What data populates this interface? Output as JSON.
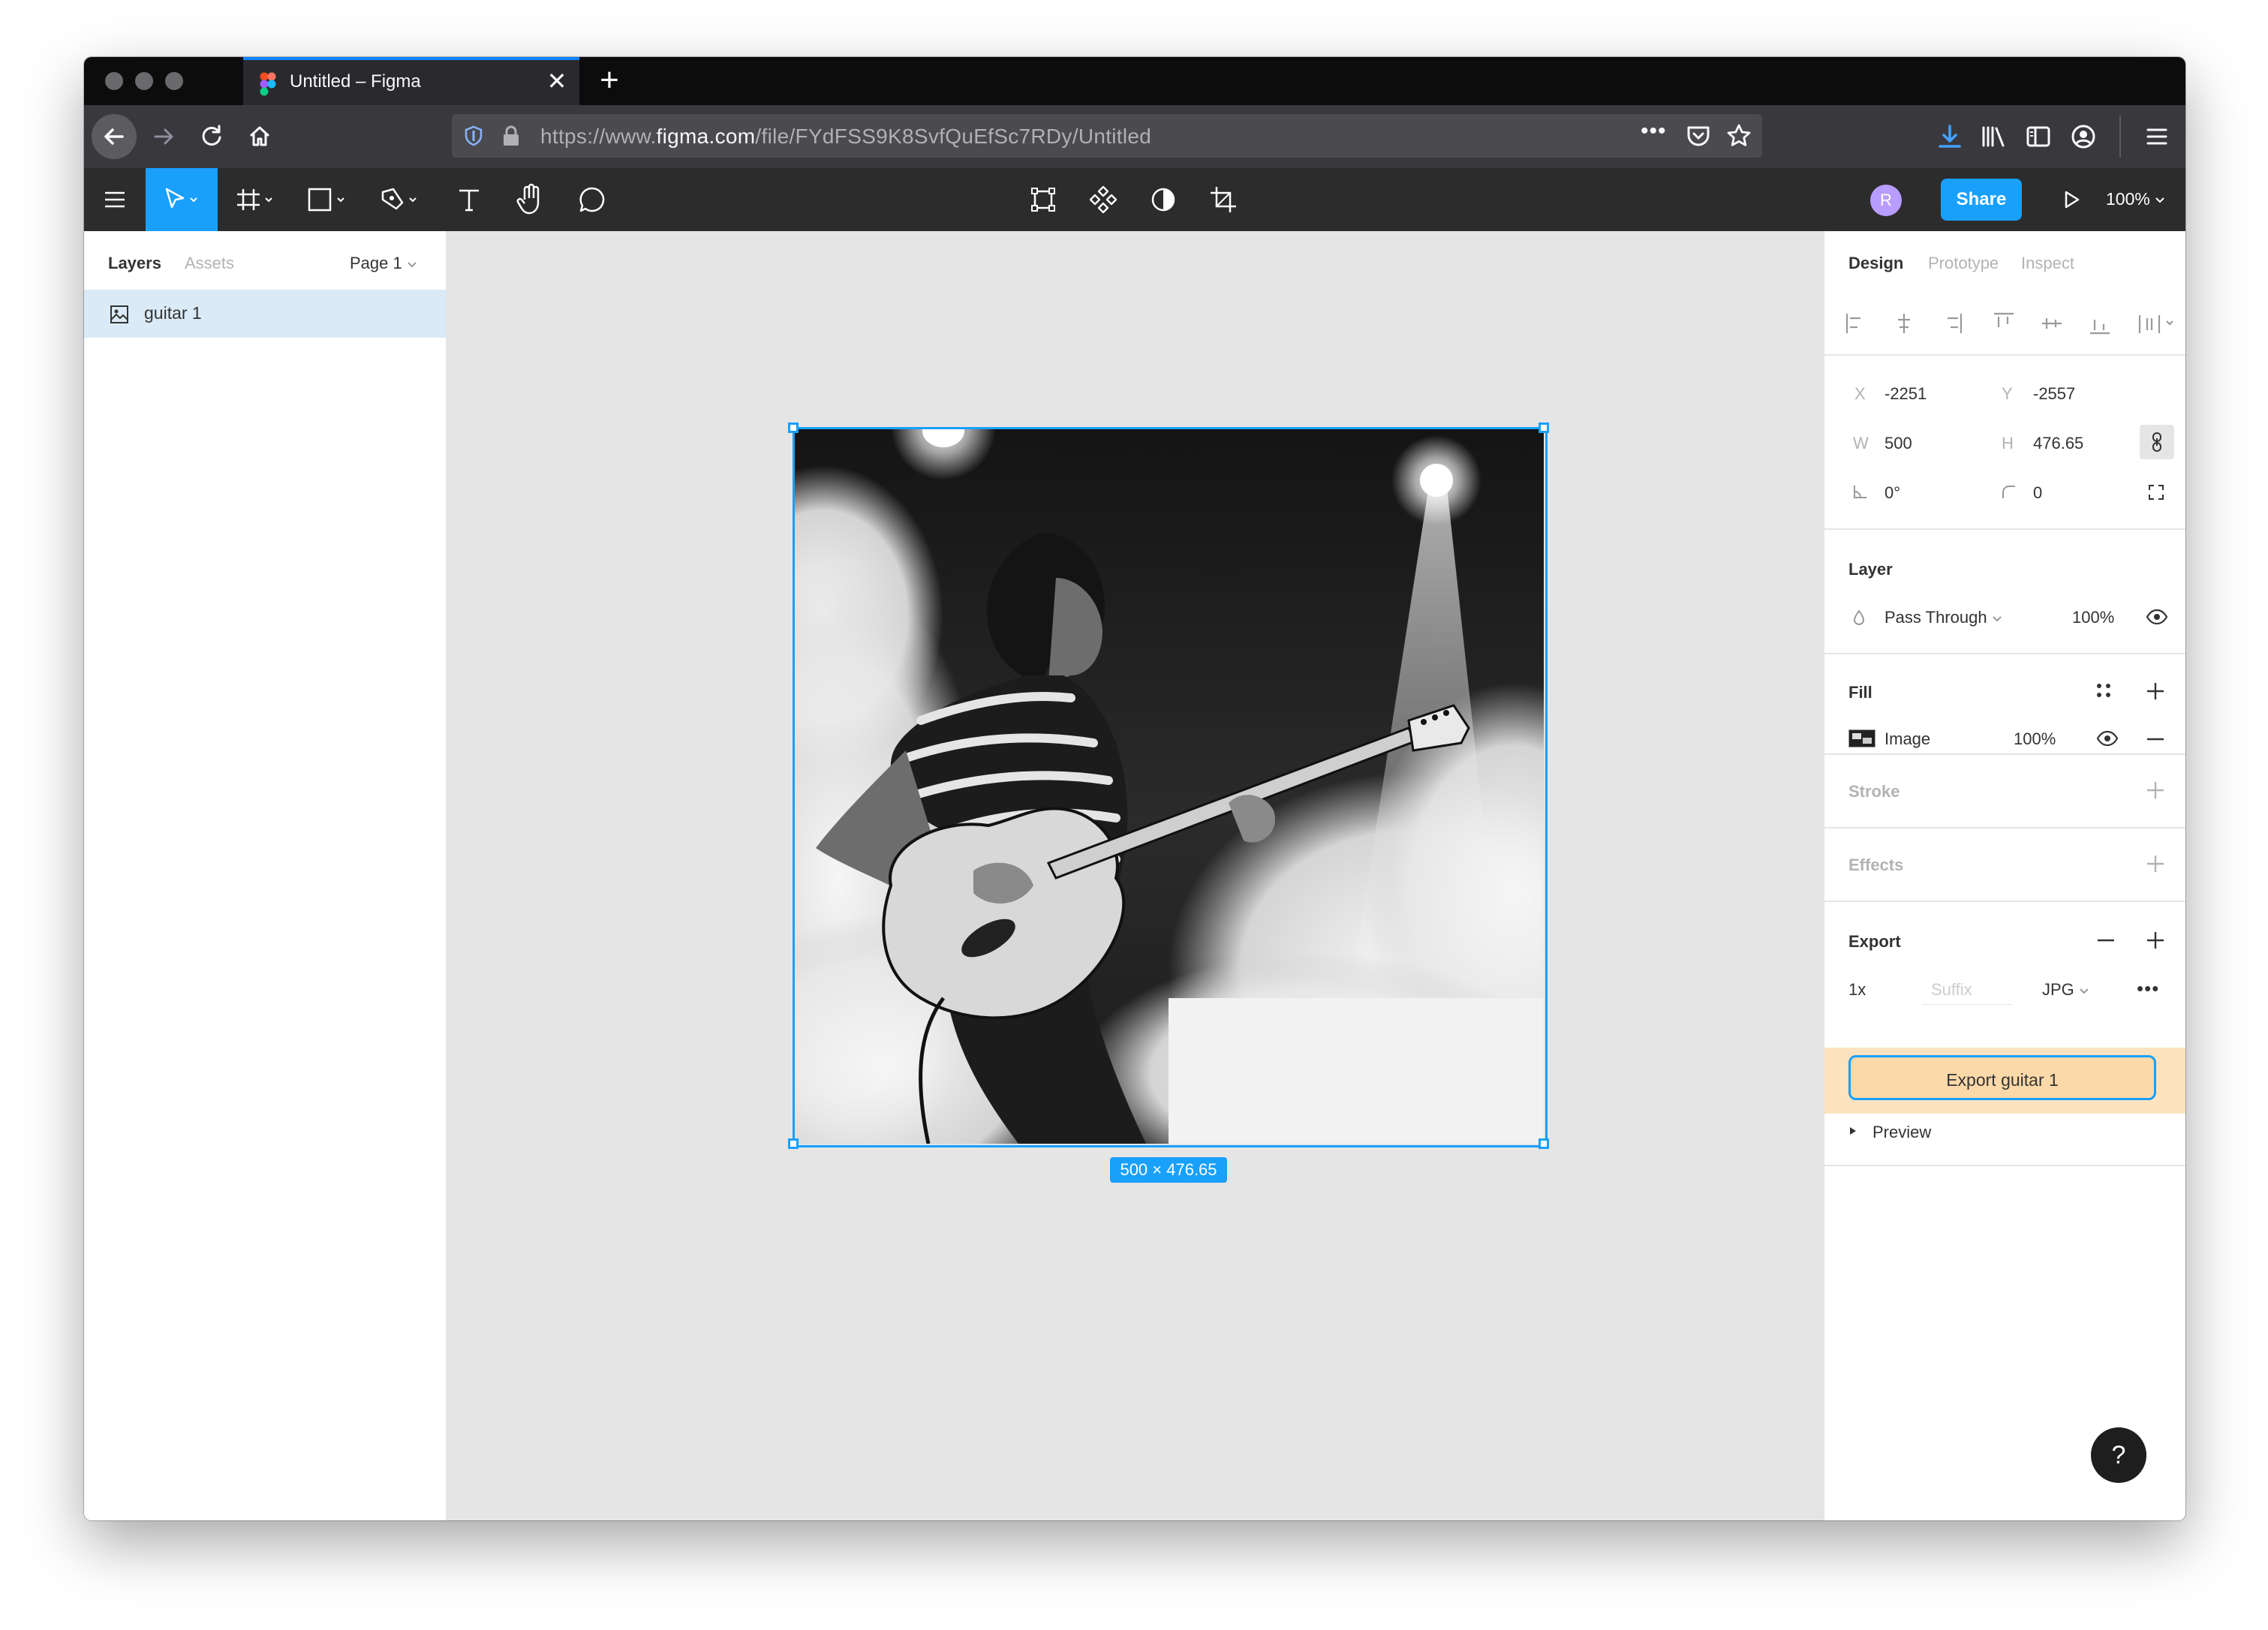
{
  "browser": {
    "tab_title": "Untitled – Figma",
    "url_prefix": "https://www.",
    "url_domain": "figma.com",
    "url_path": "/file/FYdFSS9K8SvfQuEfSc7RDy/Untitled"
  },
  "toolbar": {
    "avatar_initial": "R",
    "share_label": "Share",
    "zoom_label": "100%"
  },
  "left_panel": {
    "tab_layers": "Layers",
    "tab_assets": "Assets",
    "page_selector": "Page 1",
    "layers": [
      {
        "name": "guitar 1",
        "icon": "image-icon"
      }
    ]
  },
  "canvas": {
    "selection_size": "500 × 476.65"
  },
  "right_panel": {
    "tabs": {
      "design": "Design",
      "prototype": "Prototype",
      "inspect": "Inspect"
    },
    "transform": {
      "x_label": "X",
      "x_value": "-2251",
      "y_label": "Y",
      "y_value": "-2557",
      "w_label": "W",
      "w_value": "500",
      "h_label": "H",
      "h_value": "476.65",
      "rotation_value": "0°",
      "radius_value": "0"
    },
    "layer": {
      "title": "Layer",
      "blend_mode": "Pass Through",
      "opacity": "100%"
    },
    "fill": {
      "title": "Fill",
      "type": "Image",
      "opacity": "100%"
    },
    "stroke": {
      "title": "Stroke"
    },
    "effects": {
      "title": "Effects"
    },
    "export": {
      "title": "Export",
      "scale": "1x",
      "suffix_placeholder": "Suffix",
      "format": "JPG",
      "button_label": "Export guitar 1",
      "preview_label": "Preview"
    }
  },
  "help": {
    "label": "?"
  },
  "colors": {
    "accent": "#18a0fb",
    "export_highlight": "#fde3bf",
    "selected_layer": "#daebf7"
  }
}
